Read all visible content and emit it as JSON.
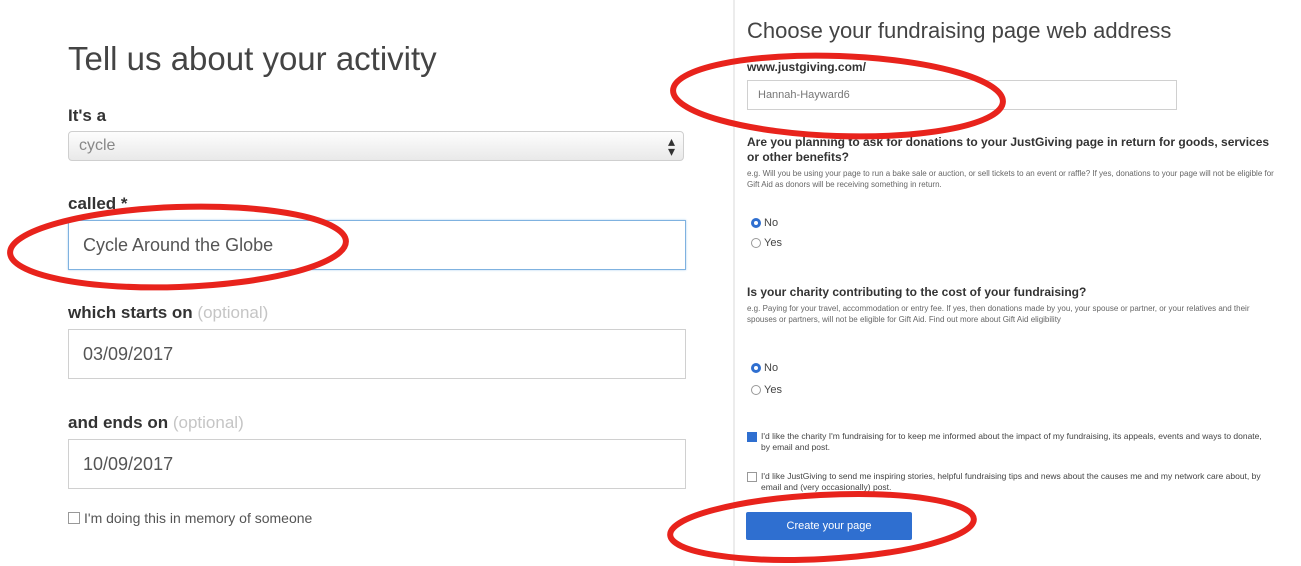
{
  "left": {
    "title": "Tell us about your activity",
    "its_a_label": "It's a",
    "activity_type": "cycle",
    "called_label": "called *",
    "called_value": "Cycle Around the Globe",
    "starts_label": "which starts on",
    "starts_optional": "(optional)",
    "starts_value": "03/09/2017",
    "ends_label": "and ends on",
    "ends_optional": "(optional)",
    "ends_value": "10/09/2017",
    "memory_label": "I'm doing this in memory of someone"
  },
  "right": {
    "title": "Choose your fundraising page web address",
    "url_prefix": "www.justgiving.com/",
    "url_value": "Hannah-Hayward6",
    "q1": "Are you planning to ask for donations to your JustGiving page in return for goods, services or other benefits?",
    "q1_help": "e.g. Will you be using your page to run a bake sale or auction, or sell tickets to an event or raffle? If yes, donations to your page will not be eligible for Gift Aid as donors will be receiving something in return.",
    "q1_no": "No",
    "q1_yes": "Yes",
    "q2": "Is your charity contributing to the cost of your fundraising?",
    "q2_help": "e.g. Paying for your travel, accommodation or entry fee. If yes, then donations made by you, your spouse or partner, or your relatives and their spouses or partners, will not be eligible for Gift Aid. Find out more about Gift Aid eligibility",
    "q2_no": "No",
    "q2_yes": "Yes",
    "consent_charity": "I'd like the charity I'm fundraising for to keep me informed about the impact of my fundraising, its appeals, events and ways to donate, by email and post.",
    "consent_justgiving": "I'd like JustGiving to send me inspiring stories, helpful fundraising tips and news about the causes me and my network care about, by email and (very occasionally) post.",
    "create_button": "Create your page"
  },
  "colors": {
    "accent": "#2f6fd0",
    "annotation": "#e8231c"
  }
}
